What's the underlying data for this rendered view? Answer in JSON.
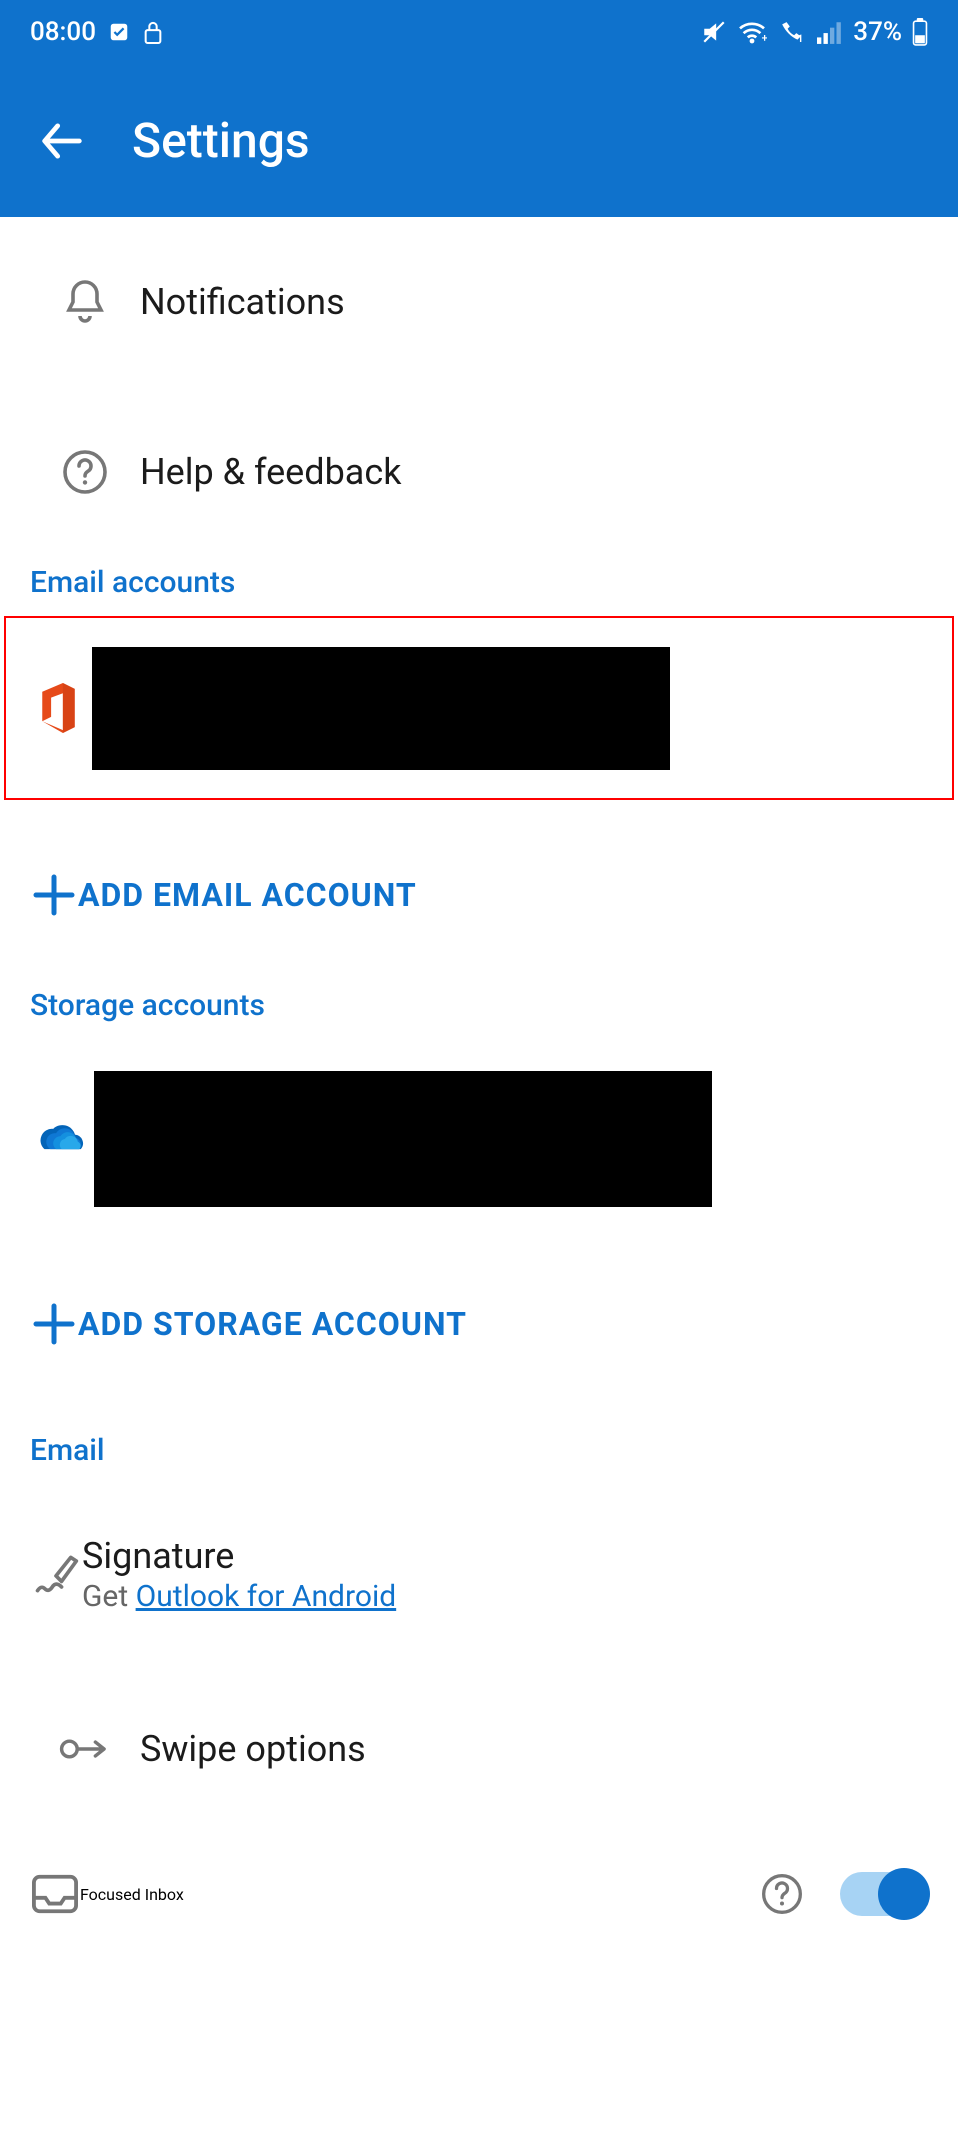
{
  "status_bar": {
    "time": "08:00",
    "battery_pct": "37%"
  },
  "app_bar": {
    "title": "Settings"
  },
  "top_items": [
    {
      "label": "Notifications"
    },
    {
      "label": "Help & feedback"
    }
  ],
  "sections": {
    "email_accounts": {
      "header": "Email accounts",
      "add_label": "ADD EMAIL ACCOUNT"
    },
    "storage_accounts": {
      "header": "Storage accounts",
      "add_label": "ADD STORAGE ACCOUNT"
    },
    "email": {
      "header": "Email",
      "signature": {
        "title": "Signature",
        "sub_prefix": "Get ",
        "sub_link": "Outlook for Android"
      },
      "swipe": "Swipe options",
      "focused": "Focused Inbox"
    }
  }
}
